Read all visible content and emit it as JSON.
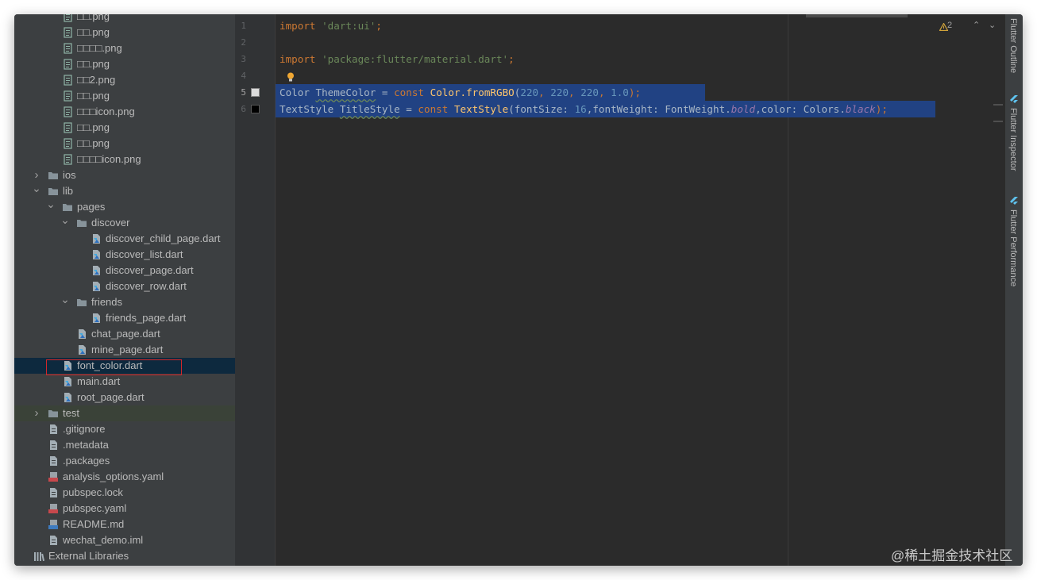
{
  "tree": {
    "items": [
      {
        "label": "□□.png",
        "kind": "image"
      },
      {
        "label": "□□.png",
        "kind": "image"
      },
      {
        "label": "□□□□.png",
        "kind": "image"
      },
      {
        "label": "□□.png",
        "kind": "image"
      },
      {
        "label": "□□2.png",
        "kind": "image"
      },
      {
        "label": "□□.png",
        "kind": "image"
      },
      {
        "label": "□□□icon.png",
        "kind": "image"
      },
      {
        "label": "□□.png",
        "kind": "image"
      },
      {
        "label": "□□.png",
        "kind": "image"
      },
      {
        "label": "□□□□icon.png",
        "kind": "image"
      },
      {
        "label": "ios",
        "kind": "folder"
      },
      {
        "label": "lib",
        "kind": "folder"
      },
      {
        "label": "pages",
        "kind": "folder"
      },
      {
        "label": "discover",
        "kind": "folder"
      },
      {
        "label": "discover_child_page.dart",
        "kind": "dart"
      },
      {
        "label": "discover_list.dart",
        "kind": "dart"
      },
      {
        "label": "discover_page.dart",
        "kind": "dart"
      },
      {
        "label": "discover_row.dart",
        "kind": "dart"
      },
      {
        "label": "friends",
        "kind": "folder"
      },
      {
        "label": "friends_page.dart",
        "kind": "dart"
      },
      {
        "label": "chat_page.dart",
        "kind": "dart"
      },
      {
        "label": "mine_page.dart",
        "kind": "dart"
      },
      {
        "label": "font_color.dart",
        "kind": "dart"
      },
      {
        "label": "main.dart",
        "kind": "dart"
      },
      {
        "label": "root_page.dart",
        "kind": "dart"
      },
      {
        "label": "test",
        "kind": "folder"
      },
      {
        "label": ".gitignore",
        "kind": "text"
      },
      {
        "label": ".metadata",
        "kind": "text"
      },
      {
        "label": ".packages",
        "kind": "text"
      },
      {
        "label": "analysis_options.yaml",
        "kind": "yaml"
      },
      {
        "label": "pubspec.lock",
        "kind": "text"
      },
      {
        "label": "pubspec.yaml",
        "kind": "yaml"
      },
      {
        "label": "README.md",
        "kind": "md"
      },
      {
        "label": "wechat_demo.iml",
        "kind": "text"
      },
      {
        "label": "External Libraries",
        "kind": "libs"
      }
    ]
  },
  "editor": {
    "line_numbers": [
      "1",
      "2",
      "3",
      "4",
      "5",
      "6"
    ],
    "code": {
      "l1_kw": "import",
      "l1_str": "'dart:ui'",
      "l1_end": ";",
      "l3_kw": "import",
      "l3_str": "'package:flutter/material.dart'",
      "l3_end": ";",
      "l5_type": "Color",
      "l5_var": "ThemeColor",
      "l5_eq": " = ",
      "l5_const": "const",
      "l5_call": "Color.fromRGBO",
      "l5_open": "(",
      "l5_n1": "220",
      "l5_c1": ", ",
      "l5_n2": "220",
      "l5_c2": ", ",
      "l5_n3": "220",
      "l5_c3": ", ",
      "l5_n4": "1.0",
      "l5_end": ");",
      "l6_type": "TextStyle",
      "l6_var": "TitleStyle",
      "l6_eq": " = ",
      "l6_const": "const",
      "l6_call": "TextStyle",
      "l6_open": "(fontSize: ",
      "l6_n1": "16",
      "l6_mid": ",fontWeight: FontWeight.",
      "l6_bold": "bold",
      "l6_mid2": ",color: Colors.",
      "l6_black": "black",
      "l6_end": ");"
    },
    "warnings": "2"
  },
  "right_tabs": [
    "Flutter Outline",
    "Flutter Inspector",
    "Flutter Performance"
  ],
  "watermark": "@稀土掘金技术社区",
  "colors": {
    "selection": "#214283",
    "keyword": "#cc7832",
    "string": "#6a8759",
    "number": "#6897bb",
    "function": "#ffc66d",
    "constant": "#9876aa",
    "swatch_line5": "#dcdcdc",
    "swatch_line6": "#000000"
  }
}
